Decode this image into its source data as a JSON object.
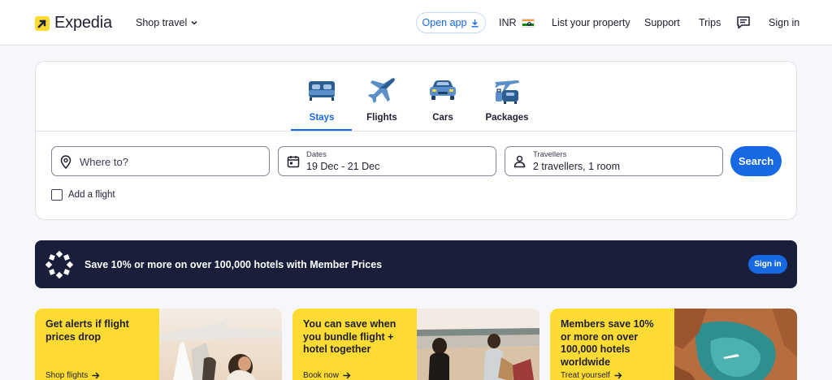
{
  "header": {
    "logo_text": "Expedia",
    "shop_travel": "Shop travel",
    "open_app": "Open app",
    "currency": "INR",
    "list_property": "List your property",
    "support": "Support",
    "trips": "Trips",
    "sign_in": "Sign in"
  },
  "tabs": [
    {
      "label": "Stays",
      "icon": "bed-icon",
      "active": true
    },
    {
      "label": "Flights",
      "icon": "airplane-icon",
      "active": false
    },
    {
      "label": "Cars",
      "icon": "car-icon",
      "active": false
    },
    {
      "label": "Packages",
      "icon": "packages-icon",
      "active": false
    }
  ],
  "search": {
    "destination_placeholder": "Where to?",
    "dates_label": "Dates",
    "dates_value": "19 Dec - 21 Dec",
    "travellers_label": "Travellers",
    "travellers_value": "2 travellers, 1 room",
    "search_button": "Search",
    "add_flight_label": "Add a flight",
    "add_flight_checked": false
  },
  "member_banner": {
    "text": "Save 10% or more on over 100,000 hotels with Member Prices",
    "sign_in": "Sign in"
  },
  "promos": [
    {
      "headline": "Get alerts if flight prices drop",
      "cta": "Shop flights"
    },
    {
      "headline": "You can save when you bundle flight + hotel together",
      "cta": "Book now"
    },
    {
      "headline": "Members save 10% or more on over 100,000 hotels worldwide",
      "cta": "Treat yourself"
    }
  ],
  "colors": {
    "brand_blue": "#1668e3",
    "brand_yellow": "#fddb32",
    "navy": "#191e3b"
  }
}
